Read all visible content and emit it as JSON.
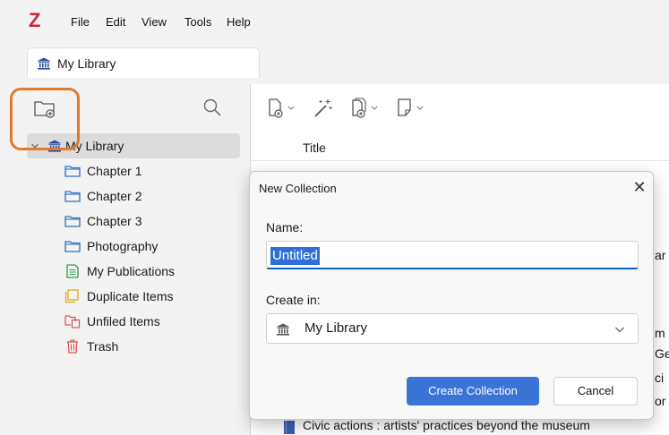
{
  "app": {
    "logo": "Z"
  },
  "menu": [
    "File",
    "Edit",
    "View",
    "Tools",
    "Help"
  ],
  "tab": {
    "label": "My Library",
    "icon": "library-icon"
  },
  "sidebar": {
    "new_collection_icon": "folder-plus-icon",
    "search_icon": "search-icon",
    "root": {
      "label": "My Library",
      "icon": "library-icon",
      "expanded": true
    },
    "items": [
      {
        "label": "Chapter 1",
        "icon": "folder-icon"
      },
      {
        "label": "Chapter 2",
        "icon": "folder-icon"
      },
      {
        "label": "Chapter 3",
        "icon": "folder-icon"
      },
      {
        "label": "Photography",
        "icon": "folder-icon"
      },
      {
        "label": "My Publications",
        "icon": "publications-icon"
      },
      {
        "label": "Duplicate Items",
        "icon": "duplicate-icon"
      },
      {
        "label": "Unfiled Items",
        "icon": "unfiled-icon"
      },
      {
        "label": "Trash",
        "icon": "trash-icon"
      }
    ]
  },
  "items_pane": {
    "column_title": "Title",
    "last_row": "Civic actions : artists' practices beyond the museum",
    "visible_fragments": [
      "ar",
      "m",
      "Ge",
      "ci",
      "or"
    ]
  },
  "dialog": {
    "title": "New Collection",
    "name_label": "Name:",
    "name_value": "Untitled",
    "create_in_label": "Create in:",
    "create_in_value": "My Library",
    "create_button": "Create Collection",
    "cancel_button": "Cancel"
  },
  "colors": {
    "accent": "#3b73d6",
    "highlight_ring": "#e07a2e",
    "logo": "#cc2936",
    "folder": "#2f6fbd",
    "publications": "#2e9a4a",
    "duplicate": "#e3a81a",
    "unfiled": "#d9534f",
    "trash": "#d9534f"
  }
}
